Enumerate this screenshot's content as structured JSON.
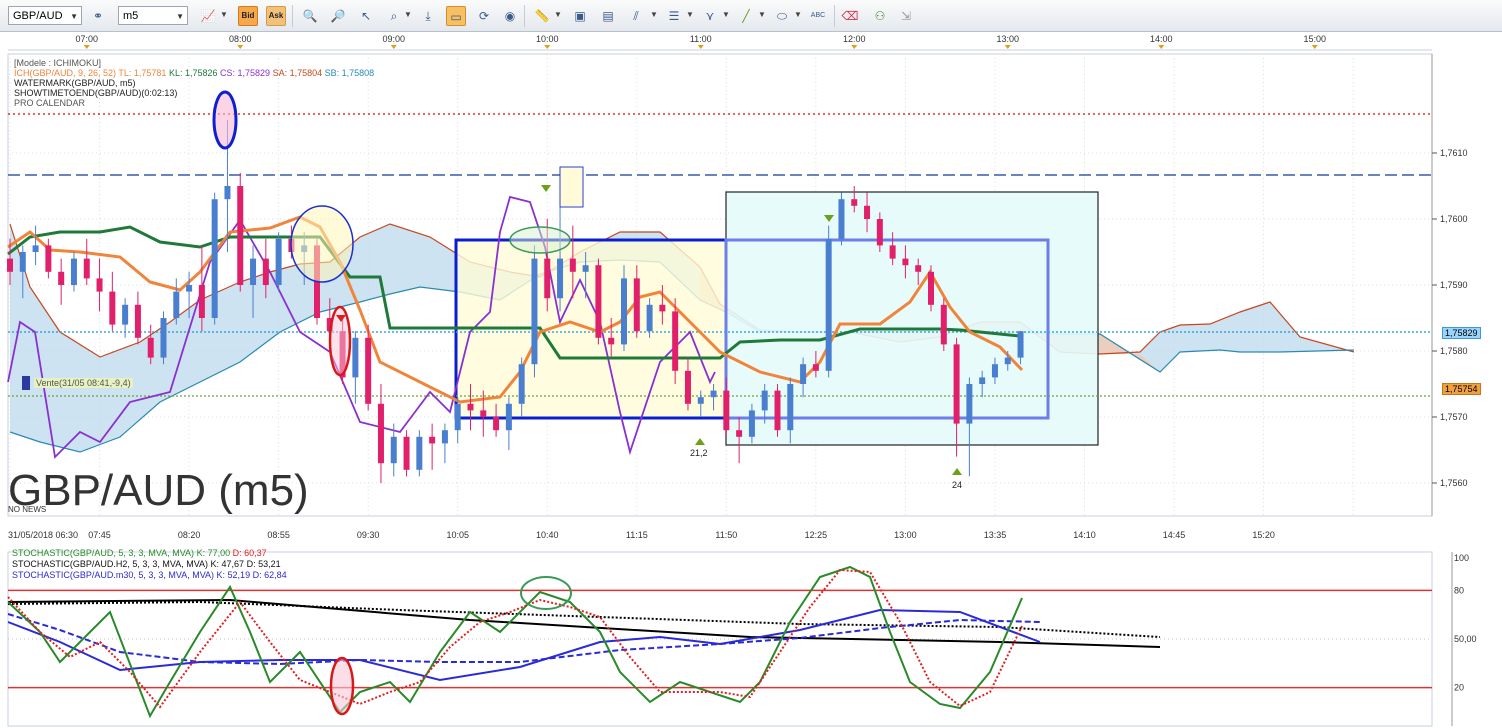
{
  "toolbar": {
    "symbol": "GBP/AUD",
    "timeframe": "m5",
    "bid_label": "Bid",
    "ask_label": "Ask"
  },
  "time_axis_top": [
    "07:00",
    "08:00",
    "09:00",
    "10:00",
    "11:00",
    "12:00",
    "13:00",
    "14:00",
    "15:00"
  ],
  "time_axis_bottom": [
    "31/05/2018 06:30",
    "07:45",
    "08:20",
    "08:55",
    "09:30",
    "10:05",
    "10:40",
    "11:15",
    "11:50",
    "12:25",
    "13:00",
    "13:35",
    "14:10",
    "14:45",
    "15:20"
  ],
  "price_axis": [
    "1,7610",
    "1,7600",
    "1,7590",
    "1,7580",
    "1,7570",
    "1,7560"
  ],
  "price_tags": {
    "current": "1,75829",
    "marker": "1,75754"
  },
  "indicators": {
    "model": "[Modele : ICHIMOKU]",
    "ich": "ICH(GBP/AUD, 9, 26, 52)",
    "tl": "TL: 1,75781",
    "kl": "KL: 1,75826",
    "cs": "CS: 1,75829",
    "sa": "SA: 1,75804",
    "sb": "SB: 1,75808",
    "watermark": "WATERMARK(GBP/AUD, m5)",
    "showtime": "SHOWTIMETOEND(GBP/AUD)(0:02:13)",
    "calendar": "PRO CALENDAR"
  },
  "watermark": "GBP/AUD (m5)",
  "no_news": "NO NEWS",
  "trade_label": "Vente(31/05 08:41,-9,4)",
  "annotations": {
    "label_a": "21,2",
    "label_b": "24"
  },
  "stochastic": {
    "line1_name": "STOCHASTIC(GBP/AUD, 5, 3, 3, MVA, MVA)",
    "line1_k": "K: 77,00",
    "line1_d": "D: 60,37",
    "line2": "STOCHASTIC(GBP/AUD.H2, 5, 3, 3, MVA, MVA)  K: 47,67  D: 53,21",
    "line3": "STOCHASTIC(GBP/AUD.m30, 5, 3, 3, MVA, MVA)  K: 52,19  D: 62,84",
    "axis": [
      "100",
      "80",
      "50,00",
      "20"
    ]
  },
  "colors": {
    "up": "#4a7fd0",
    "down": "#e0206a",
    "tenkan": "#f0843a",
    "kijun": "#1f7a3a",
    "chikou": "#8a30d0",
    "senkouA": "#c8461e",
    "senkouB": "#2a8ab0",
    "box": "#1a2fd0",
    "stochK": "#2a8a2a",
    "stochD": "#e02020"
  },
  "chart_data": {
    "type": "candlestick",
    "symbol": "GBP/AUD",
    "timeframe": "m5",
    "y_range": [
      1.7555,
      1.7625
    ],
    "candles": [
      {
        "t": "06:30",
        "o": 1.7594,
        "h": 1.7597,
        "l": 1.759,
        "c": 1.7592
      },
      {
        "t": "06:35",
        "o": 1.7592,
        "h": 1.7596,
        "l": 1.7588,
        "c": 1.7595
      },
      {
        "t": "06:40",
        "o": 1.7595,
        "h": 1.7599,
        "l": 1.7593,
        "c": 1.7596
      },
      {
        "t": "06:45",
        "o": 1.7596,
        "h": 1.7597,
        "l": 1.7591,
        "c": 1.7592
      },
      {
        "t": "06:50",
        "o": 1.7592,
        "h": 1.7594,
        "l": 1.7587,
        "c": 1.759
      },
      {
        "t": "06:55",
        "o": 1.759,
        "h": 1.7595,
        "l": 1.7589,
        "c": 1.7594
      },
      {
        "t": "07:00",
        "o": 1.7594,
        "h": 1.7597,
        "l": 1.759,
        "c": 1.7591
      },
      {
        "t": "07:05",
        "o": 1.7591,
        "h": 1.7594,
        "l": 1.7586,
        "c": 1.7589
      },
      {
        "t": "07:10",
        "o": 1.7589,
        "h": 1.7592,
        "l": 1.7583,
        "c": 1.7584
      },
      {
        "t": "07:15",
        "o": 1.7584,
        "h": 1.7588,
        "l": 1.7582,
        "c": 1.7587
      },
      {
        "t": "07:20",
        "o": 1.7587,
        "h": 1.7589,
        "l": 1.7581,
        "c": 1.7582
      },
      {
        "t": "07:25",
        "o": 1.7582,
        "h": 1.7584,
        "l": 1.7578,
        "c": 1.7579
      },
      {
        "t": "07:30",
        "o": 1.7579,
        "h": 1.7586,
        "l": 1.7578,
        "c": 1.7585
      },
      {
        "t": "07:35",
        "o": 1.7585,
        "h": 1.7591,
        "l": 1.7584,
        "c": 1.7589
      },
      {
        "t": "07:40",
        "o": 1.7589,
        "h": 1.7592,
        "l": 1.7585,
        "c": 1.759
      },
      {
        "t": "07:45",
        "o": 1.759,
        "h": 1.7596,
        "l": 1.7583,
        "c": 1.7585
      },
      {
        "t": "07:50",
        "o": 1.7585,
        "h": 1.7604,
        "l": 1.7584,
        "c": 1.7603
      },
      {
        "t": "07:55",
        "o": 1.7603,
        "h": 1.7615,
        "l": 1.7595,
        "c": 1.7605
      },
      {
        "t": "08:00",
        "o": 1.7605,
        "h": 1.7607,
        "l": 1.7589,
        "c": 1.759
      },
      {
        "t": "08:05",
        "o": 1.759,
        "h": 1.7596,
        "l": 1.7585,
        "c": 1.7594
      },
      {
        "t": "08:10",
        "o": 1.7594,
        "h": 1.7597,
        "l": 1.7588,
        "c": 1.759
      },
      {
        "t": "08:15",
        "o": 1.759,
        "h": 1.7598,
        "l": 1.7589,
        "c": 1.7597
      },
      {
        "t": "08:20",
        "o": 1.7597,
        "h": 1.7599,
        "l": 1.7594,
        "c": 1.7595
      },
      {
        "t": "08:25",
        "o": 1.7595,
        "h": 1.7598,
        "l": 1.759,
        "c": 1.7596
      },
      {
        "t": "08:30",
        "o": 1.7596,
        "h": 1.7597,
        "l": 1.7584,
        "c": 1.7585
      },
      {
        "t": "08:35",
        "o": 1.7585,
        "h": 1.7588,
        "l": 1.758,
        "c": 1.7583
      },
      {
        "t": "08:40",
        "o": 1.7583,
        "h": 1.7585,
        "l": 1.7575,
        "c": 1.7576
      },
      {
        "t": "08:45",
        "o": 1.7576,
        "h": 1.7583,
        "l": 1.7572,
        "c": 1.7582
      },
      {
        "t": "08:50",
        "o": 1.7582,
        "h": 1.7584,
        "l": 1.7571,
        "c": 1.7572
      },
      {
        "t": "08:55",
        "o": 1.7572,
        "h": 1.7575,
        "l": 1.756,
        "c": 1.7563
      },
      {
        "t": "09:00",
        "o": 1.7563,
        "h": 1.7569,
        "l": 1.7561,
        "c": 1.7567
      },
      {
        "t": "09:05",
        "o": 1.7567,
        "h": 1.7568,
        "l": 1.7561,
        "c": 1.7562
      },
      {
        "t": "09:10",
        "o": 1.7562,
        "h": 1.7568,
        "l": 1.7561,
        "c": 1.7567
      },
      {
        "t": "09:15",
        "o": 1.7567,
        "h": 1.7569,
        "l": 1.7562,
        "c": 1.7566
      },
      {
        "t": "09:20",
        "o": 1.7566,
        "h": 1.7569,
        "l": 1.7563,
        "c": 1.7568
      },
      {
        "t": "09:25",
        "o": 1.7568,
        "h": 1.7573,
        "l": 1.7566,
        "c": 1.7572
      },
      {
        "t": "09:30",
        "o": 1.7572,
        "h": 1.7575,
        "l": 1.7568,
        "c": 1.7571
      },
      {
        "t": "09:35",
        "o": 1.7571,
        "h": 1.7574,
        "l": 1.7567,
        "c": 1.757
      },
      {
        "t": "09:40",
        "o": 1.757,
        "h": 1.7572,
        "l": 1.7567,
        "c": 1.7568
      },
      {
        "t": "09:45",
        "o": 1.7568,
        "h": 1.7573,
        "l": 1.7565,
        "c": 1.7572
      },
      {
        "t": "09:50",
        "o": 1.7572,
        "h": 1.7579,
        "l": 1.757,
        "c": 1.7578
      },
      {
        "t": "09:55",
        "o": 1.7578,
        "h": 1.7596,
        "l": 1.7576,
        "c": 1.7594
      },
      {
        "t": "10:00",
        "o": 1.7594,
        "h": 1.76,
        "l": 1.7586,
        "c": 1.7588
      },
      {
        "t": "10:05",
        "o": 1.7588,
        "h": 1.7602,
        "l": 1.7586,
        "c": 1.7594
      },
      {
        "t": "10:10",
        "o": 1.7594,
        "h": 1.7599,
        "l": 1.7588,
        "c": 1.7592
      },
      {
        "t": "10:15",
        "o": 1.7592,
        "h": 1.7595,
        "l": 1.7588,
        "c": 1.7593
      },
      {
        "t": "10:20",
        "o": 1.7593,
        "h": 1.7594,
        "l": 1.7581,
        "c": 1.7582
      },
      {
        "t": "10:25",
        "o": 1.7582,
        "h": 1.7585,
        "l": 1.7579,
        "c": 1.7581
      },
      {
        "t": "10:30",
        "o": 1.7581,
        "h": 1.7593,
        "l": 1.758,
        "c": 1.7591
      },
      {
        "t": "10:35",
        "o": 1.7591,
        "h": 1.7593,
        "l": 1.7582,
        "c": 1.7583
      },
      {
        "t": "10:40",
        "o": 1.7583,
        "h": 1.7588,
        "l": 1.7582,
        "c": 1.7587
      },
      {
        "t": "10:45",
        "o": 1.7587,
        "h": 1.759,
        "l": 1.7584,
        "c": 1.7586
      },
      {
        "t": "10:50",
        "o": 1.7586,
        "h": 1.7588,
        "l": 1.7575,
        "c": 1.7577
      },
      {
        "t": "10:55",
        "o": 1.7577,
        "h": 1.7579,
        "l": 1.7571,
        "c": 1.7572
      },
      {
        "t": "11:00",
        "o": 1.7572,
        "h": 1.7574,
        "l": 1.757,
        "c": 1.7573
      },
      {
        "t": "11:05",
        "o": 1.7573,
        "h": 1.7575,
        "l": 1.7571,
        "c": 1.7574
      },
      {
        "t": "11:10",
        "o": 1.7574,
        "h": 1.7576,
        "l": 1.7567,
        "c": 1.7568
      },
      {
        "t": "11:15",
        "o": 1.7568,
        "h": 1.757,
        "l": 1.7563,
        "c": 1.7567
      },
      {
        "t": "11:20",
        "o": 1.7567,
        "h": 1.7572,
        "l": 1.7566,
        "c": 1.7571
      },
      {
        "t": "11:25",
        "o": 1.7571,
        "h": 1.7575,
        "l": 1.7569,
        "c": 1.7574
      },
      {
        "t": "11:30",
        "o": 1.7574,
        "h": 1.7575,
        "l": 1.7567,
        "c": 1.7568
      },
      {
        "t": "11:35",
        "o": 1.7568,
        "h": 1.7576,
        "l": 1.7566,
        "c": 1.7575
      },
      {
        "t": "11:40",
        "o": 1.7575,
        "h": 1.7579,
        "l": 1.7573,
        "c": 1.7578
      },
      {
        "t": "11:45",
        "o": 1.7578,
        "h": 1.758,
        "l": 1.7576,
        "c": 1.7577
      },
      {
        "t": "11:50",
        "o": 1.7577,
        "h": 1.7599,
        "l": 1.7576,
        "c": 1.7597
      },
      {
        "t": "11:55",
        "o": 1.7597,
        "h": 1.7604,
        "l": 1.7596,
        "c": 1.7603
      },
      {
        "t": "12:00",
        "o": 1.7603,
        "h": 1.7605,
        "l": 1.7601,
        "c": 1.7602
      },
      {
        "t": "12:05",
        "o": 1.7602,
        "h": 1.7604,
        "l": 1.7598,
        "c": 1.76
      },
      {
        "t": "12:10",
        "o": 1.76,
        "h": 1.7601,
        "l": 1.7595,
        "c": 1.7596
      },
      {
        "t": "12:15",
        "o": 1.7596,
        "h": 1.7598,
        "l": 1.7593,
        "c": 1.7594
      },
      {
        "t": "12:20",
        "o": 1.7594,
        "h": 1.7596,
        "l": 1.7591,
        "c": 1.7593
      },
      {
        "t": "12:25",
        "o": 1.7593,
        "h": 1.7594,
        "l": 1.759,
        "c": 1.7592
      },
      {
        "t": "12:30",
        "o": 1.7592,
        "h": 1.7593,
        "l": 1.7586,
        "c": 1.7587
      },
      {
        "t": "12:35",
        "o": 1.7587,
        "h": 1.7588,
        "l": 1.758,
        "c": 1.7581
      },
      {
        "t": "12:40",
        "o": 1.7581,
        "h": 1.7582,
        "l": 1.7564,
        "c": 1.7569
      },
      {
        "t": "12:45",
        "o": 1.7569,
        "h": 1.7576,
        "l": 1.7561,
        "c": 1.7575
      },
      {
        "t": "12:50",
        "o": 1.7575,
        "h": 1.7577,
        "l": 1.7573,
        "c": 1.7576
      },
      {
        "t": "12:55",
        "o": 1.7576,
        "h": 1.7579,
        "l": 1.7575,
        "c": 1.7578
      },
      {
        "t": "13:00",
        "o": 1.7578,
        "h": 1.758,
        "l": 1.7577,
        "c": 1.7579
      },
      {
        "t": "13:05",
        "o": 1.7579,
        "h": 1.7583,
        "l": 1.7578,
        "c": 1.7583
      }
    ]
  }
}
